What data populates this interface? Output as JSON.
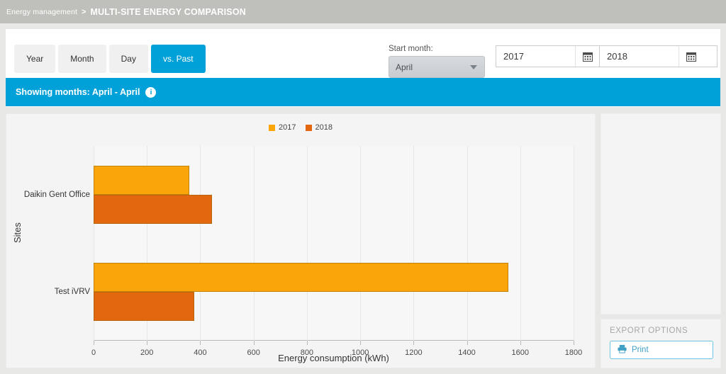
{
  "breadcrumb": {
    "parent": "Energy management",
    "separator": ">",
    "current": "MULTI-SITE ENERGY COMPARISON"
  },
  "toolbar": {
    "tabs": [
      {
        "label": "Year",
        "active": false
      },
      {
        "label": "Month",
        "active": false
      },
      {
        "label": "Day",
        "active": false
      },
      {
        "label": "vs. Past",
        "active": true
      }
    ],
    "start_month": {
      "label": "Start month:",
      "value": "April",
      "caret_icon": "chevron-down-icon"
    },
    "year_from": {
      "value": "2017",
      "calendar_icon": "calendar-icon"
    },
    "year_to": {
      "value": "2018",
      "calendar_icon": "calendar-icon"
    }
  },
  "banner": {
    "text": "Showing months: April - April",
    "info_icon": "i",
    "color": "#00a0d8"
  },
  "export": {
    "title": "EXPORT OPTIONS",
    "print_label": "Print",
    "print_icon": "printer-icon"
  },
  "chart_data": {
    "type": "bar",
    "orientation": "horizontal",
    "title": "",
    "xlabel": "Energy consumption (kWh)",
    "ylabel": "Sites",
    "categories": [
      "Daikin Gent Office",
      "Test iVRV"
    ],
    "series": [
      {
        "name": "2017",
        "color": "#faa50a",
        "values": [
          360,
          1555
        ]
      },
      {
        "name": "2018",
        "color": "#e2670e",
        "values": [
          445,
          378
        ]
      }
    ],
    "xlim": [
      0,
      1800
    ],
    "xticks": [
      0,
      200,
      400,
      600,
      800,
      1000,
      1200,
      1400,
      1600,
      1800
    ],
    "xtick_labels": [
      "0",
      "200",
      "400",
      "600",
      "800",
      "1000",
      "1200",
      "1400",
      "1600",
      "1800"
    ],
    "grid": true,
    "legend_position": "top-center"
  }
}
